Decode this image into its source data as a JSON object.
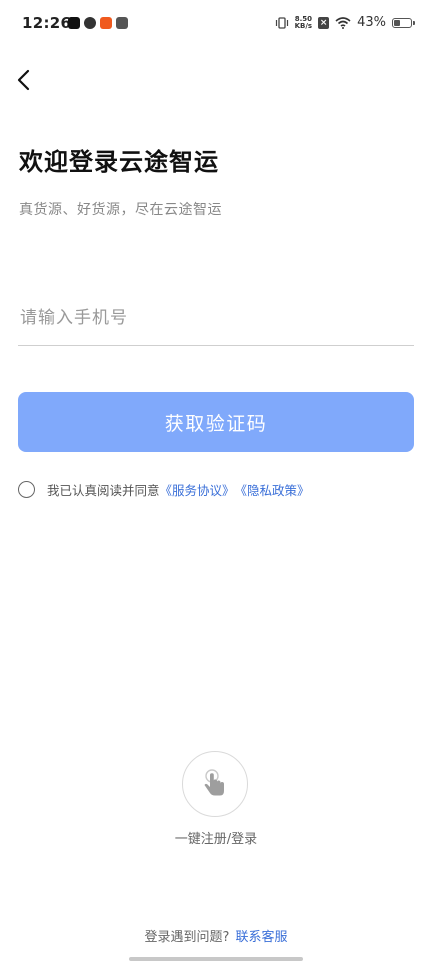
{
  "status_bar": {
    "time": "12:26",
    "net_speed_value": "8.50",
    "net_speed_unit": "KB/s",
    "battery_percent": "43%",
    "battery_level": 0.43,
    "icons": [
      "tiktok-icon",
      "wechat-icon",
      "orange-app-icon",
      "inbox-icon",
      "vibrate-icon",
      "x-badge-icon",
      "wifi-icon",
      "battery-icon"
    ]
  },
  "header": {
    "title": "欢迎登录云途智运",
    "subtitle": "真货源、好货源，尽在云途智运"
  },
  "form": {
    "phone_placeholder": "请输入手机号",
    "phone_value": "",
    "get_code_label": "获取验证码",
    "button_color": "#80a9fb"
  },
  "agreement": {
    "prefix": "我已认真阅读并同意",
    "service_link": "《服务协议》",
    "privacy_link": "《隐私政策》",
    "checked": false,
    "link_color": "#3a6fd8"
  },
  "onetap": {
    "label": "一键注册/登录",
    "icon": "tap-hand-icon"
  },
  "footer": {
    "question": "登录遇到问题?",
    "contact_link": "联系客服"
  }
}
